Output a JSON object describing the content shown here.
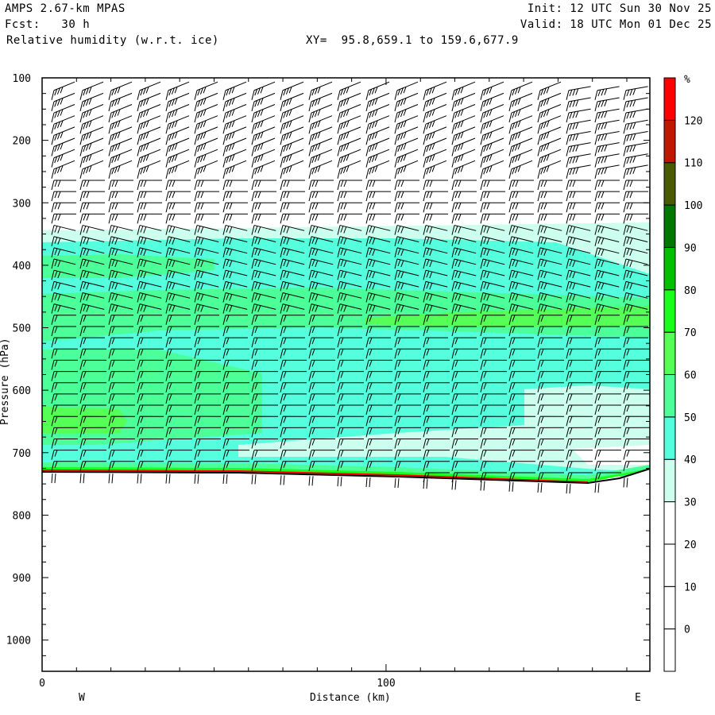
{
  "header": {
    "model": "AMPS 2.67-km MPAS",
    "forecast": "Fcst:   30 h",
    "field": "Relative humidity (w.r.t. ice)",
    "xy": "XY=  95.8,659.1 to 159.6,677.9",
    "init": "Init: 12 UTC Sun 30 Nov 25",
    "valid": "Valid: 18 UTC Mon 01 Dec 25"
  },
  "chart_data": {
    "type": "heatmap",
    "title": "Relative humidity (w.r.t. ice)",
    "xlabel": "Distance (km)",
    "ylabel": "Pressure (hPa)",
    "xlim": [
      0,
      176.7
    ],
    "ylim": [
      1050,
      100
    ],
    "x_ticks": [
      "0",
      "100"
    ],
    "x_tick_values": [
      0,
      100
    ],
    "x_minor_step": 10,
    "y_ticks": [
      "100",
      "200",
      "300",
      "400",
      "500",
      "600",
      "700",
      "800",
      "900",
      "1000"
    ],
    "y_tick_values": [
      100,
      200,
      300,
      400,
      500,
      600,
      700,
      800,
      900,
      1000
    ],
    "west_label": "W",
    "east_label": "E",
    "colorbar": {
      "unit": "%",
      "labels": [
        "120",
        "110",
        "100",
        "90",
        "80",
        "70",
        "60",
        "50",
        "40",
        "30",
        "20",
        "10",
        "0"
      ],
      "levels": [
        -10,
        0,
        10,
        20,
        30,
        40,
        50,
        60,
        70,
        80,
        90,
        100,
        110,
        120,
        130
      ],
      "colors": [
        "#ffffff",
        "#ffffff",
        "#ffffff",
        "#ffffff",
        "#ccffee",
        "#55ffdd",
        "#4cff99",
        "#55ff55",
        "#1aff1a",
        "#00c000",
        "#007700",
        "#4a5a00",
        "#c01800",
        "#ff0000"
      ]
    },
    "overlay": "wind barbs"
  }
}
